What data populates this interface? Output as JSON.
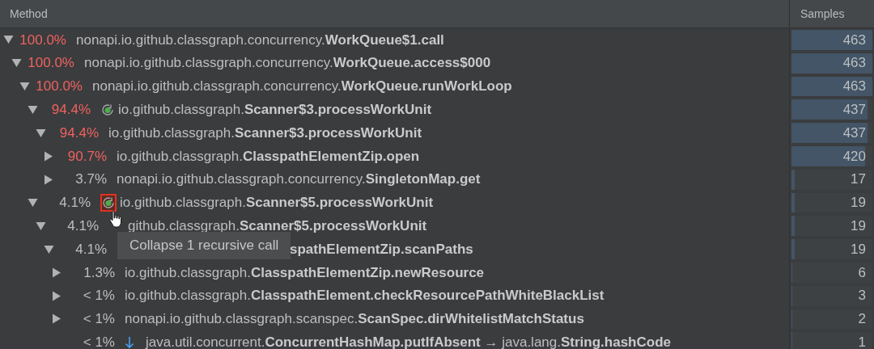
{
  "columns": [
    {
      "label": "Method"
    },
    {
      "label": "Samples"
    }
  ],
  "rows": [
    {
      "expanded": true,
      "hot": true,
      "percent": "100.0%",
      "name": "nonapi.io.github.classgraph.concurrency.**WorkQueue$1.call**",
      "samples": "463",
      "level": 1,
      "children": [
        {
          "expanded": true,
          "hot": true,
          "percent": "100.0%",
          "name": "nonapi.io.github.classgraph.concurrency.**WorkQueue.access$000**",
          "samples": "463",
          "level": 1,
          "children": [
            {
              "expanded": true,
              "hot": true,
              "percent": "100.0%",
              "name": "nonapi.io.github.classgraph.concurrency.**WorkQueue.runWorkLoop**",
              "samples": "463",
              "level": 1,
              "children": [
                {
                  "expanded": true,
                  "hot": true,
                  "percent": "94.4%",
                  "icon": {
                    "kind": "recursion",
                    "hovered": false
                  },
                  "name": "io.github.classgraph.**Scanner$3.processWorkUnit**",
                  "samples": "437",
                  "level": 0.944,
                  "children": [
                    {
                      "expanded": true,
                      "hot": true,
                      "percent": "94.4%",
                      "name": "io.github.classgraph.**Scanner$3.processWorkUnit**",
                      "samples": "437",
                      "level": 0.944,
                      "children": [
                        {
                          "expanded": false,
                          "hot": true,
                          "percent": "90.7%",
                          "name": "io.github.classgraph.**ClasspathElementZip.open**",
                          "samples": "420",
                          "level": 0.907
                        },
                        {
                          "expanded": false,
                          "hot": false,
                          "percent": "3.7%",
                          "name": "nonapi.io.github.classgraph.concurrency.**SingletonMap.get**",
                          "samples": "17",
                          "level": 0.037
                        }
                      ]
                    }
                  ]
                },
                {
                  "expanded": true,
                  "hot": false,
                  "percent": "4.1%",
                  "icon": {
                    "kind": "recursion",
                    "hovered": true
                  },
                  "name": "io.github.classgraph.**Scanner$5.processWorkUnit**",
                  "samples": "19",
                  "level": 0.041,
                  "children": [
                    {
                      "expanded": true,
                      "hot": false,
                      "percent": "4.1%",
                      "pointer": true,
                      "name": "github.classgraph.**Scanner$5.processWorkUnit**",
                      "samples": "19",
                      "level": 0.041,
                      "children": [
                        {
                          "expanded": true,
                          "hot": false,
                          "percent": "4.1%",
                          "partly_hidden": true,
                          "name": "**spathElementZip.scanPaths**",
                          "samples": "19",
                          "level": 0.041,
                          "children": [
                            {
                              "expanded": false,
                              "hot": false,
                              "percent": "1.3%",
                              "name": "io.github.classgraph.**ClasspathElementZip.newResource**",
                              "samples": "6",
                              "level": 0.013
                            },
                            {
                              "expanded": false,
                              "hot": false,
                              "percent": "< 1%",
                              "name": "io.github.classgraph.**ClasspathElement.checkResourcePathWhiteBlackList**",
                              "samples": "3",
                              "level": 0.006
                            },
                            {
                              "expanded": false,
                              "hot": false,
                              "percent": "< 1%",
                              "name": "nonapi.io.github.classgraph.scanspec.**ScanSpec.dirWhitelistMatchStatus**",
                              "samples": "2",
                              "level": 0.004
                            },
                            {
                              "hot": false,
                              "percent": "< 1%",
                              "icon": {
                                "kind": "down-arrow"
                              },
                              "name": "java.util.concurrent.**ConcurrentHashMap.putIfAbsent** → java.lang.**String.hashCode**",
                              "samples": "1",
                              "level": 0.002
                            }
                          ]
                        }
                      ]
                    }
                  ]
                }
              ]
            }
          ]
        }
      ]
    }
  ],
  "tooltip": {
    "text": "Collapse 1 recursive call"
  }
}
